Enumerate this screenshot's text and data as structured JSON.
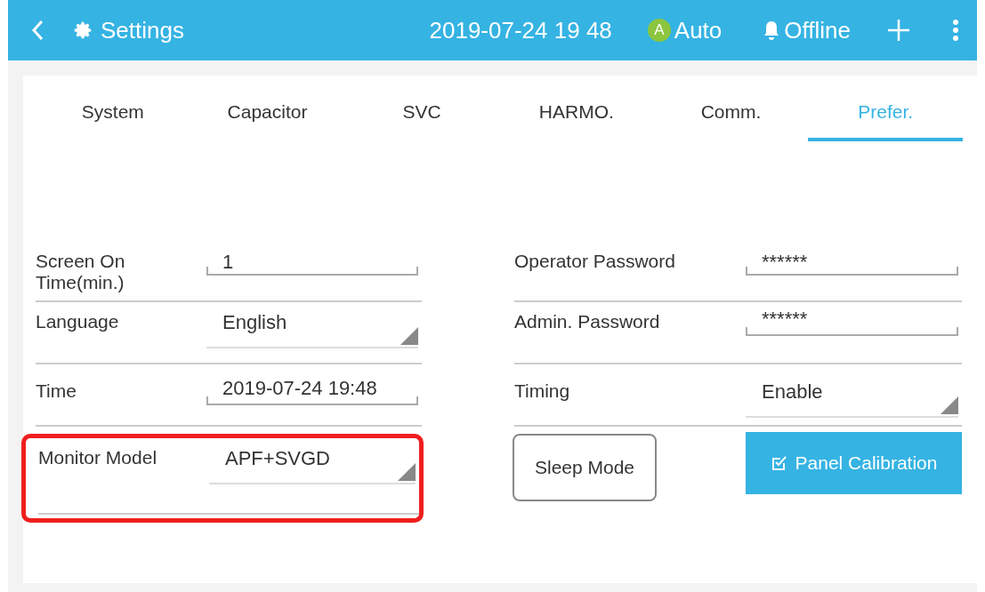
{
  "top_bar": {
    "title": "Settings",
    "datetime": "2019-07-24 19 48",
    "mode_badge": "A",
    "mode": "Auto",
    "connection": "Offline"
  },
  "tabs": [
    {
      "label": "System",
      "selected": false
    },
    {
      "label": "Capacitor",
      "selected": false
    },
    {
      "label": "SVC",
      "selected": false
    },
    {
      "label": "HARMO.",
      "selected": false
    },
    {
      "label": "Comm.",
      "selected": false
    },
    {
      "label": "Prefer.",
      "selected": true
    }
  ],
  "left_fields": [
    {
      "label": "Screen On Time(min.)",
      "kind": "text",
      "value": "1",
      "highlighted": false
    },
    {
      "label": "Language",
      "kind": "dropdown",
      "value": "English",
      "highlighted": false
    },
    {
      "label": "Time",
      "kind": "text",
      "value": "2019-07-24 19:48",
      "highlighted": false
    },
    {
      "label": "Monitor Model",
      "kind": "dropdown",
      "value": "APF+SVGD",
      "highlighted": true
    }
  ],
  "right_fields": [
    {
      "label": "Operator Password",
      "kind": "password",
      "value": "******"
    },
    {
      "label": "Admin. Password",
      "kind": "password",
      "value": "******"
    },
    {
      "label": "Timing",
      "kind": "dropdown",
      "value": "Enable"
    }
  ],
  "buttons": [
    {
      "label": "Sleep Mode",
      "kind": "outline"
    },
    {
      "label": "Panel Calibration",
      "kind": "filled"
    }
  ]
}
